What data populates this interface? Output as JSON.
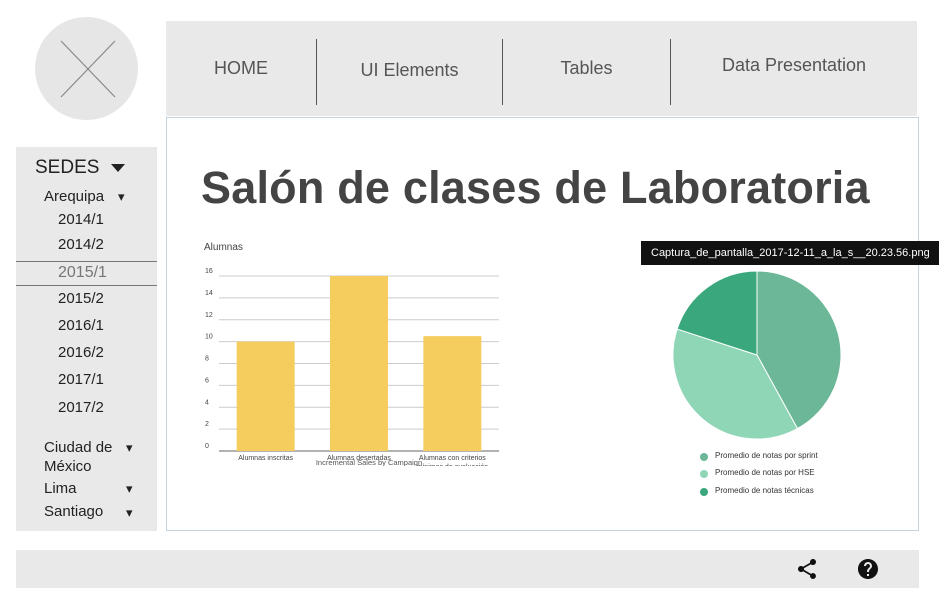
{
  "nav": {
    "items": [
      {
        "label": "HOME"
      },
      {
        "label": "UI Elements"
      },
      {
        "label": "Tables"
      },
      {
        "label": "Data Presentation"
      }
    ]
  },
  "sidebar": {
    "title": "SEDES",
    "cities": [
      {
        "label": "Arequipa",
        "expanded": true,
        "years": [
          "2014/1",
          "2014/2",
          "2015/1",
          "2015/2",
          "2016/1",
          "2016/2",
          "2017/1",
          "2017/2"
        ],
        "selected": "2015/1"
      },
      {
        "label": "Ciudad de México",
        "line1": "Ciudad de",
        "line2": "México"
      },
      {
        "label": "Lima"
      },
      {
        "label": "Santiago"
      }
    ],
    "chevron": "▾"
  },
  "main": {
    "title": "Salón de clases de Laboratoria",
    "tooltip": "Captura_de_pantalla_2017-12-11_a_la_s__20.23.56.png"
  },
  "chart_data": [
    {
      "type": "bar",
      "title": "Alumnas",
      "xlabel": "Incremental Sales by Campaign",
      "categories": [
        "Alumnas inscritas",
        "Alumnas desertadas",
        "Alumnas con criterios mínimos de evaluación"
      ],
      "category_lines": [
        [
          "Alumnas inscritas"
        ],
        [
          "Alumnas desertadas"
        ],
        [
          "Alumnas con criterios",
          "mínimos de evaluación"
        ]
      ],
      "values": [
        10,
        16,
        10.5
      ],
      "yticks": [
        0,
        2,
        4,
        6,
        8,
        10,
        12,
        14,
        16
      ],
      "ylim": [
        0,
        16
      ],
      "color": "#f5cd5e",
      "grid": true
    },
    {
      "type": "pie",
      "labels": [
        "Promedio de notas por sprint",
        "Promedio de notas por HSE",
        "Promedio de notas técnicas"
      ],
      "values": [
        42,
        38,
        20
      ],
      "colors": [
        "#6bb797",
        "#8fd6b7",
        "#3aa87c"
      ],
      "legend": "bottom"
    }
  ],
  "footer": {
    "share_icon": "share-icon",
    "help_icon": "help-icon"
  }
}
